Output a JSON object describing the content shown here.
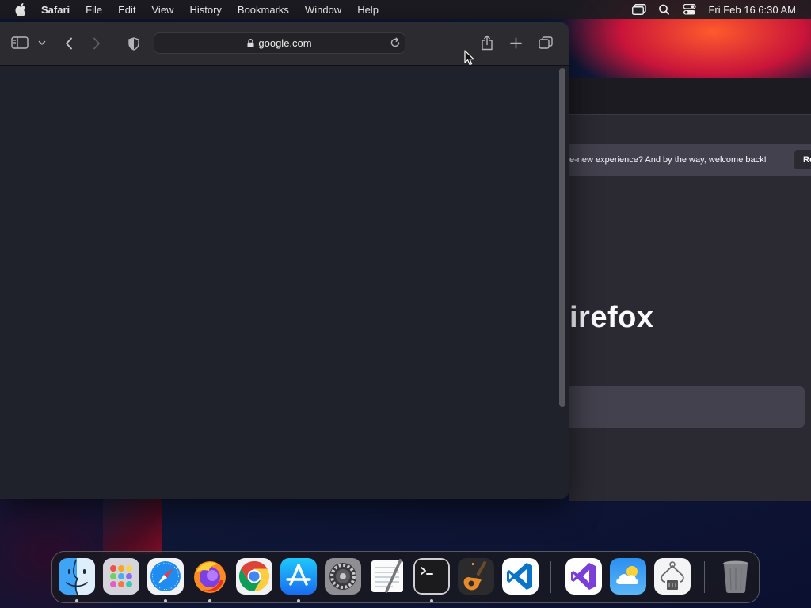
{
  "menubar": {
    "app_name": "Safari",
    "items": [
      "File",
      "Edit",
      "View",
      "History",
      "Bookmarks",
      "Window",
      "Help"
    ],
    "clock": "Fri Feb 16  6:30 AM"
  },
  "safari": {
    "address": {
      "url": "google.com"
    }
  },
  "background_window": {
    "notification_text": "e-new experience? And by the way, welcome back!",
    "notification_button": "Re",
    "brand_text": "irefox"
  },
  "dock": {
    "apps": [
      {
        "name": "Finder",
        "icon": "finder-icon",
        "running": true
      },
      {
        "name": "Launchpad",
        "icon": "launchpad-icon",
        "running": false
      },
      {
        "name": "Safari",
        "icon": "safari-icon",
        "running": true
      },
      {
        "name": "Firefox",
        "icon": "firefox-icon",
        "running": true
      },
      {
        "name": "Chrome",
        "icon": "chrome-icon",
        "running": false
      },
      {
        "name": "App Store",
        "icon": "app-store-icon",
        "running": true
      },
      {
        "name": "System Settings",
        "icon": "system-settings-icon",
        "running": false
      },
      {
        "name": "TextEdit",
        "icon": "textedit-icon",
        "running": false
      },
      {
        "name": "Terminal",
        "icon": "terminal-icon",
        "running": true
      },
      {
        "name": "GarageBand",
        "icon": "garageband-icon",
        "running": false
      },
      {
        "name": "Visual Studio Code",
        "icon": "vscode-icon",
        "running": false
      },
      {
        "name": "Visual Studio",
        "icon": "visual-studio-icon",
        "running": false
      },
      {
        "name": "Weather",
        "icon": "weather-icon",
        "running": false
      },
      {
        "name": "System Information",
        "icon": "system-information-icon",
        "running": false
      },
      {
        "name": "Trash",
        "icon": "trash-icon",
        "running": false
      }
    ]
  },
  "colors": {
    "safari_page_bg": "#1f212b",
    "safari_toolbar_bg": "#2c2c30",
    "firefox_bg": "#2b2a33",
    "firefox_notification_bg": "#42414d"
  }
}
